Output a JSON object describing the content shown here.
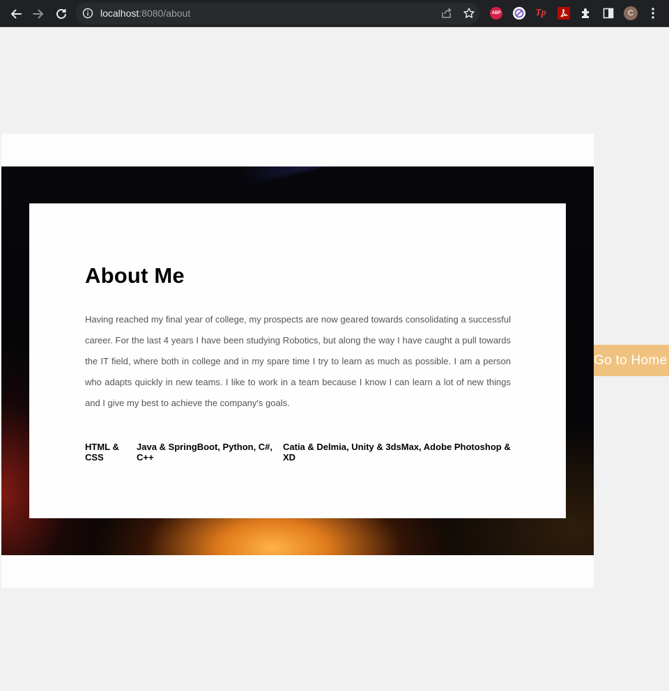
{
  "browser": {
    "url_host": "localhost",
    "url_rest": ":8080/about",
    "extensions": {
      "abp_label": "ABP",
      "tp_label": "Tp"
    },
    "profile_initial": "C"
  },
  "about": {
    "title": "About Me",
    "bio": "Having reached my final year of college, my prospects are now geared towards consolidating a successful career. For the last 4 years I have been studying Robotics, but along the way I have caught a pull towards the IT field, where both in college and in my spare time I try to learn as much as possible. I am a person who adapts quickly in new teams. I like to work in a team because I know I can learn a lot of new things and I give my best to achieve the company's goals.",
    "skills": [
      "HTML & CSS",
      "Java & SpringBoot, Python, C#, C++",
      "Catia & Delmia, Unity & 3dsMax, Adobe Photoshop & XD"
    ]
  },
  "home_button": {
    "label": "Go to Home"
  },
  "colors": {
    "chrome_bg": "#202124",
    "page_bg": "#f1f1f1",
    "button_bg": "#f0c27f"
  }
}
